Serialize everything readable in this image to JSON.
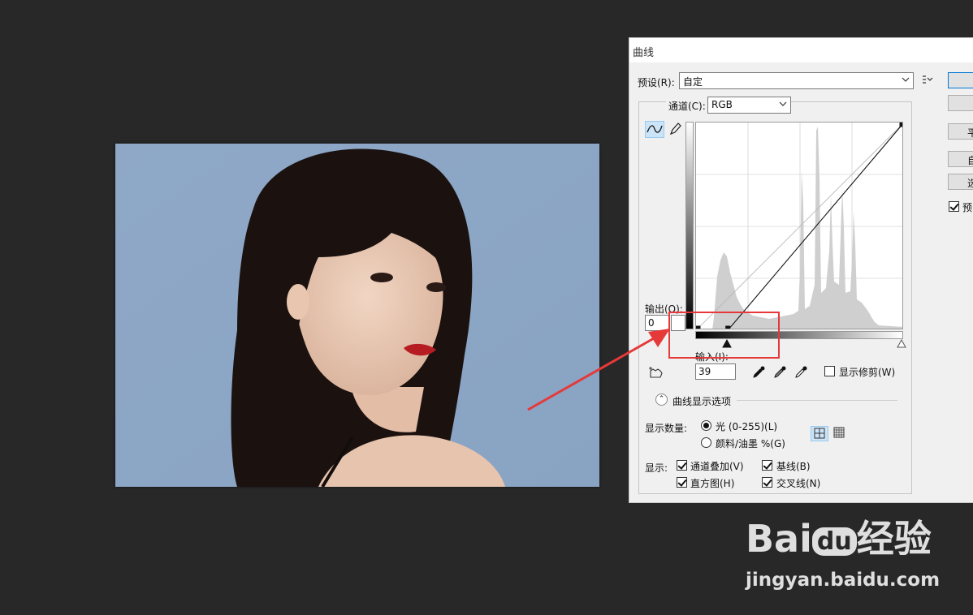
{
  "dialog": {
    "title": "曲线",
    "preset_label": "预设(R):",
    "preset_value": "自定",
    "channel_label": "通道(C):",
    "channel_value": "RGB",
    "output_label": "输出(O):",
    "output_value": "0",
    "input_label": "输入(I):",
    "input_value": "39",
    "show_clipping_label": "显示修剪(W)",
    "curve_options_label": "曲线显示选项",
    "show_amount_label": "显示数量:",
    "light_option": "光 (0-255)(L)",
    "pigment_option": "颜料/油墨 %(G)",
    "show_label": "显示:",
    "channel_overlay": "通道叠加(V)",
    "baseline": "基线(B)",
    "histogram": "直方图(H)",
    "intersection": "交叉线(N)",
    "side_buttons": [
      "平",
      "自",
      "选"
    ],
    "preview_label": "预"
  },
  "curve": {
    "points": [
      [
        0,
        0
      ],
      [
        39,
        0
      ],
      [
        255,
        255
      ]
    ]
  },
  "watermark": {
    "logo_prefix": "Bai",
    "logo_du": "du",
    "logo_suffix": "经验",
    "url": "jingyan.baidu.com"
  },
  "colors": {
    "highlight": "#e5393a",
    "photo_background": "#8ea7c6"
  }
}
